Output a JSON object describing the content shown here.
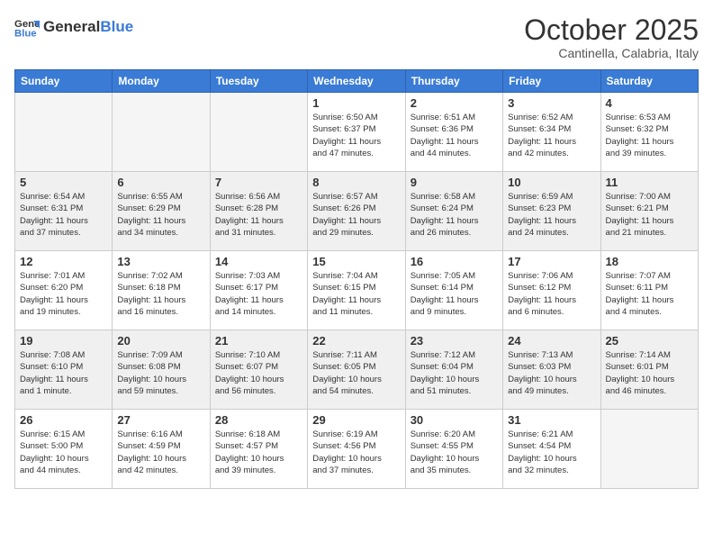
{
  "header": {
    "logo_general": "General",
    "logo_blue": "Blue",
    "month": "October 2025",
    "location": "Cantinella, Calabria, Italy"
  },
  "days_of_week": [
    "Sunday",
    "Monday",
    "Tuesday",
    "Wednesday",
    "Thursday",
    "Friday",
    "Saturday"
  ],
  "weeks": [
    {
      "shaded": false,
      "days": [
        {
          "number": "",
          "info": ""
        },
        {
          "number": "",
          "info": ""
        },
        {
          "number": "",
          "info": ""
        },
        {
          "number": "1",
          "info": "Sunrise: 6:50 AM\nSunset: 6:37 PM\nDaylight: 11 hours\nand 47 minutes."
        },
        {
          "number": "2",
          "info": "Sunrise: 6:51 AM\nSunset: 6:36 PM\nDaylight: 11 hours\nand 44 minutes."
        },
        {
          "number": "3",
          "info": "Sunrise: 6:52 AM\nSunset: 6:34 PM\nDaylight: 11 hours\nand 42 minutes."
        },
        {
          "number": "4",
          "info": "Sunrise: 6:53 AM\nSunset: 6:32 PM\nDaylight: 11 hours\nand 39 minutes."
        }
      ]
    },
    {
      "shaded": true,
      "days": [
        {
          "number": "5",
          "info": "Sunrise: 6:54 AM\nSunset: 6:31 PM\nDaylight: 11 hours\nand 37 minutes."
        },
        {
          "number": "6",
          "info": "Sunrise: 6:55 AM\nSunset: 6:29 PM\nDaylight: 11 hours\nand 34 minutes."
        },
        {
          "number": "7",
          "info": "Sunrise: 6:56 AM\nSunset: 6:28 PM\nDaylight: 11 hours\nand 31 minutes."
        },
        {
          "number": "8",
          "info": "Sunrise: 6:57 AM\nSunset: 6:26 PM\nDaylight: 11 hours\nand 29 minutes."
        },
        {
          "number": "9",
          "info": "Sunrise: 6:58 AM\nSunset: 6:24 PM\nDaylight: 11 hours\nand 26 minutes."
        },
        {
          "number": "10",
          "info": "Sunrise: 6:59 AM\nSunset: 6:23 PM\nDaylight: 11 hours\nand 24 minutes."
        },
        {
          "number": "11",
          "info": "Sunrise: 7:00 AM\nSunset: 6:21 PM\nDaylight: 11 hours\nand 21 minutes."
        }
      ]
    },
    {
      "shaded": false,
      "days": [
        {
          "number": "12",
          "info": "Sunrise: 7:01 AM\nSunset: 6:20 PM\nDaylight: 11 hours\nand 19 minutes."
        },
        {
          "number": "13",
          "info": "Sunrise: 7:02 AM\nSunset: 6:18 PM\nDaylight: 11 hours\nand 16 minutes."
        },
        {
          "number": "14",
          "info": "Sunrise: 7:03 AM\nSunset: 6:17 PM\nDaylight: 11 hours\nand 14 minutes."
        },
        {
          "number": "15",
          "info": "Sunrise: 7:04 AM\nSunset: 6:15 PM\nDaylight: 11 hours\nand 11 minutes."
        },
        {
          "number": "16",
          "info": "Sunrise: 7:05 AM\nSunset: 6:14 PM\nDaylight: 11 hours\nand 9 minutes."
        },
        {
          "number": "17",
          "info": "Sunrise: 7:06 AM\nSunset: 6:12 PM\nDaylight: 11 hours\nand 6 minutes."
        },
        {
          "number": "18",
          "info": "Sunrise: 7:07 AM\nSunset: 6:11 PM\nDaylight: 11 hours\nand 4 minutes."
        }
      ]
    },
    {
      "shaded": true,
      "days": [
        {
          "number": "19",
          "info": "Sunrise: 7:08 AM\nSunset: 6:10 PM\nDaylight: 11 hours\nand 1 minute."
        },
        {
          "number": "20",
          "info": "Sunrise: 7:09 AM\nSunset: 6:08 PM\nDaylight: 10 hours\nand 59 minutes."
        },
        {
          "number": "21",
          "info": "Sunrise: 7:10 AM\nSunset: 6:07 PM\nDaylight: 10 hours\nand 56 minutes."
        },
        {
          "number": "22",
          "info": "Sunrise: 7:11 AM\nSunset: 6:05 PM\nDaylight: 10 hours\nand 54 minutes."
        },
        {
          "number": "23",
          "info": "Sunrise: 7:12 AM\nSunset: 6:04 PM\nDaylight: 10 hours\nand 51 minutes."
        },
        {
          "number": "24",
          "info": "Sunrise: 7:13 AM\nSunset: 6:03 PM\nDaylight: 10 hours\nand 49 minutes."
        },
        {
          "number": "25",
          "info": "Sunrise: 7:14 AM\nSunset: 6:01 PM\nDaylight: 10 hours\nand 46 minutes."
        }
      ]
    },
    {
      "shaded": false,
      "days": [
        {
          "number": "26",
          "info": "Sunrise: 6:15 AM\nSunset: 5:00 PM\nDaylight: 10 hours\nand 44 minutes."
        },
        {
          "number": "27",
          "info": "Sunrise: 6:16 AM\nSunset: 4:59 PM\nDaylight: 10 hours\nand 42 minutes."
        },
        {
          "number": "28",
          "info": "Sunrise: 6:18 AM\nSunset: 4:57 PM\nDaylight: 10 hours\nand 39 minutes."
        },
        {
          "number": "29",
          "info": "Sunrise: 6:19 AM\nSunset: 4:56 PM\nDaylight: 10 hours\nand 37 minutes."
        },
        {
          "number": "30",
          "info": "Sunrise: 6:20 AM\nSunset: 4:55 PM\nDaylight: 10 hours\nand 35 minutes."
        },
        {
          "number": "31",
          "info": "Sunrise: 6:21 AM\nSunset: 4:54 PM\nDaylight: 10 hours\nand 32 minutes."
        },
        {
          "number": "",
          "info": ""
        }
      ]
    }
  ]
}
